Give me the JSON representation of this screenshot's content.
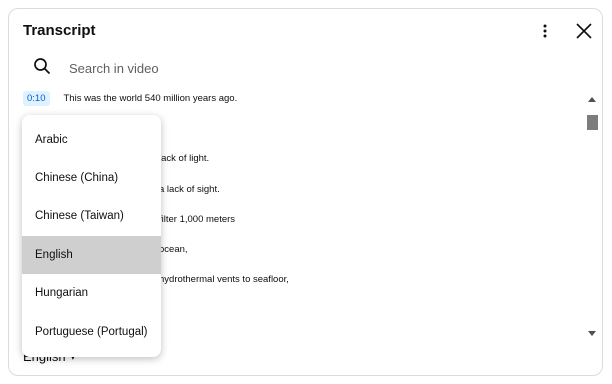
{
  "header": {
    "title": "Transcript",
    "more_icon": "more-vert-icon",
    "close_icon": "close-icon"
  },
  "search": {
    "placeholder": "Search in video",
    "icon": "search-icon"
  },
  "transcript": {
    "rows": [
      {
        "time": "0:10",
        "text": "This was the world 540 million years ago."
      },
      {
        "time": "",
        "text": "."
      },
      {
        "time": "",
        "text": "lack of light."
      },
      {
        "time": "",
        "text": "a lack of sight."
      },
      {
        "time": "",
        "text": "filter 1,000 meters"
      },
      {
        "time": "",
        "text": "ocean,"
      },
      {
        "time": "",
        "text": "hydrothermal vents to seafloor,"
      },
      {
        "time": "",
        "text": ""
      },
      {
        "time": "",
        "text": ""
      }
    ]
  },
  "language_menu": {
    "selected": "English",
    "options": [
      {
        "label": "Arabic",
        "selected": false
      },
      {
        "label": "Chinese (China)",
        "selected": false
      },
      {
        "label": "Chinese (Taiwan)",
        "selected": false
      },
      {
        "label": "English",
        "selected": true
      },
      {
        "label": "Hungarian",
        "selected": false
      },
      {
        "label": "Portuguese (Portugal)",
        "selected": false
      }
    ]
  },
  "footer": {
    "language_label": "English",
    "caret": "▾"
  },
  "colors": {
    "timestamp_bg": "#def1ff",
    "timestamp_fg": "#065fd4",
    "selected_bg": "#cfcfcf"
  }
}
